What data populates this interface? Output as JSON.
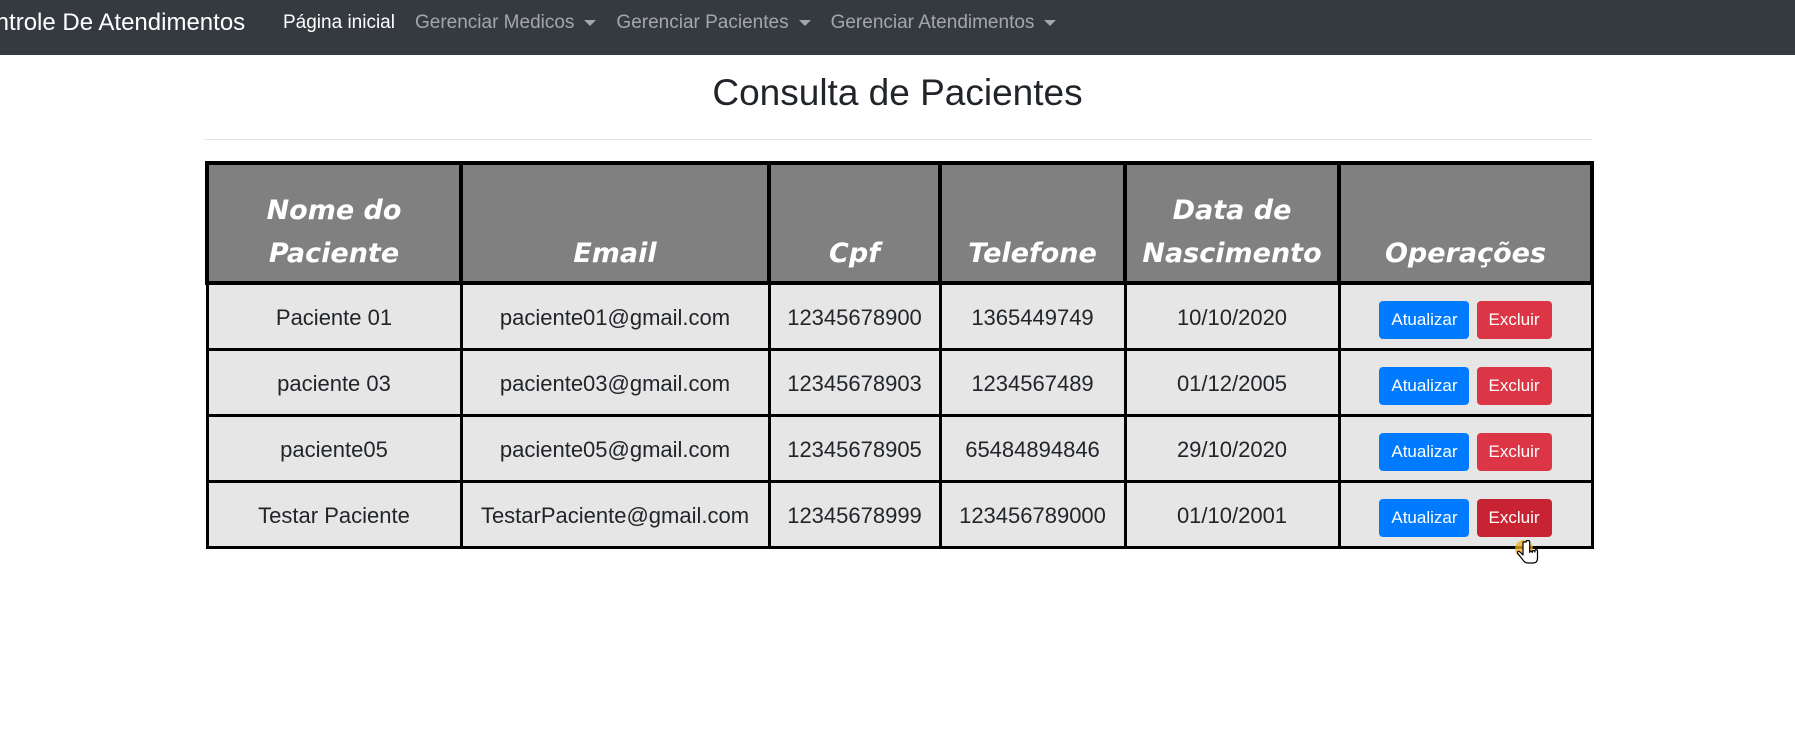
{
  "navbar": {
    "brand": "Controle De Atendimentos",
    "items": [
      {
        "label": "Página inicial",
        "active": true,
        "dropdown": false
      },
      {
        "label": "Gerenciar Medicos",
        "active": false,
        "dropdown": true
      },
      {
        "label": "Gerenciar Pacientes",
        "active": false,
        "dropdown": true
      },
      {
        "label": "Gerenciar Atendimentos",
        "active": false,
        "dropdown": true
      }
    ]
  },
  "page": {
    "title": "Consulta de Pacientes"
  },
  "table": {
    "headers": {
      "name": "Nome do Paciente",
      "email": "Email",
      "cpf": "Cpf",
      "phone": "Telefone",
      "birth": "Data de Nascimento",
      "ops": "Operações"
    },
    "rows": [
      {
        "name": "Paciente 01",
        "email": "paciente01@gmail.com",
        "cpf": "12345678900",
        "phone": "1365449749",
        "birth": "10/10/2020"
      },
      {
        "name": "paciente 03",
        "email": "paciente03@gmail.com",
        "cpf": "12345678903",
        "phone": "1234567489",
        "birth": "01/12/2005"
      },
      {
        "name": "paciente05",
        "email": "paciente05@gmail.com",
        "cpf": "12345678905",
        "phone": "65484894846",
        "birth": "29/10/2020"
      },
      {
        "name": "Testar Paciente",
        "email": "TestarPaciente@gmail.com",
        "cpf": "12345678999",
        "phone": "123456789000",
        "birth": "01/10/2001"
      }
    ]
  },
  "buttons": {
    "update": "Atualizar",
    "delete": "Excluir"
  },
  "colors": {
    "navbar_bg": "#343a40",
    "header_bg": "#808080",
    "cell_bg": "#e6e6e6",
    "update_button": "#007bff",
    "delete_button": "#dc3545",
    "delete_button_hover": "#c82333"
  },
  "icons": {
    "dropdown": "caret-down-icon",
    "cursor": "hand-pointer-icon"
  }
}
